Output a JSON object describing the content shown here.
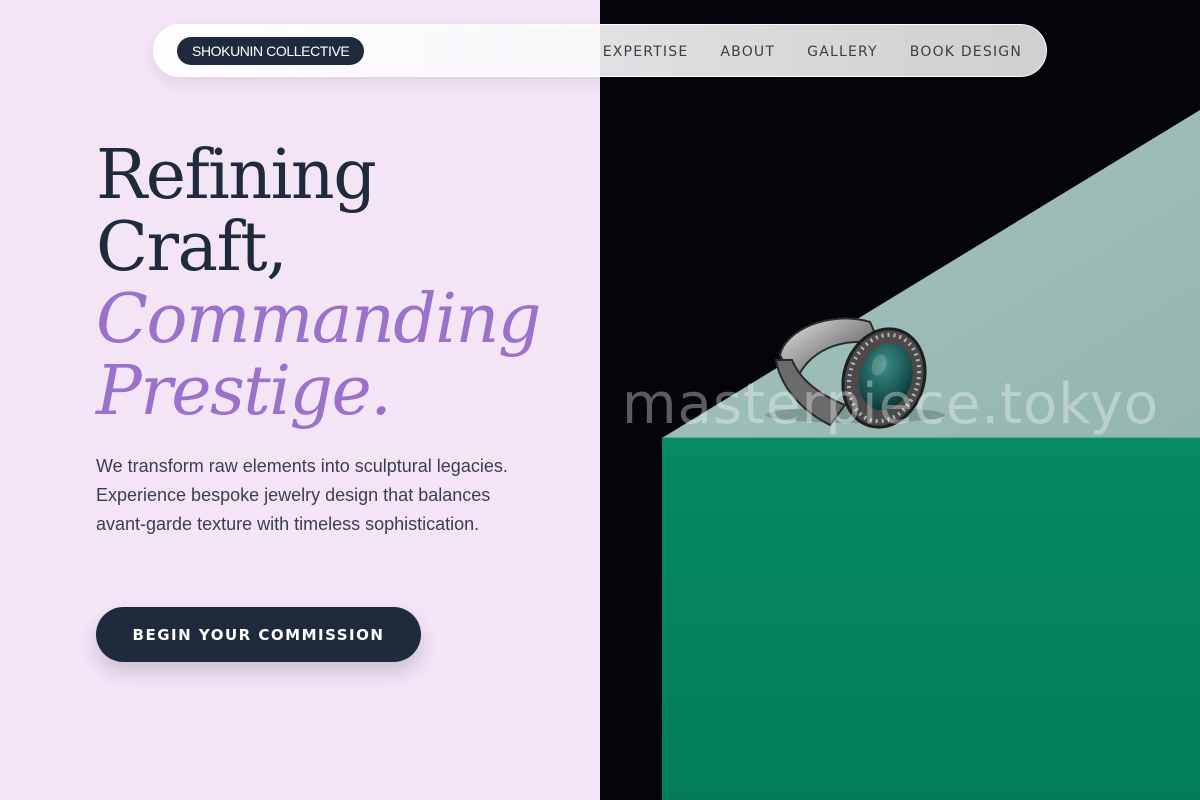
{
  "nav": {
    "brand": "SHOKUNIN COLLECTIVE",
    "links": [
      "EXPERTISE",
      "ABOUT",
      "GALLERY",
      "BOOK DESIGN"
    ]
  },
  "hero": {
    "headline_line1": "Refining",
    "headline_line2": "Craft,",
    "headline_line3": "Commanding",
    "headline_line4": "Prestige.",
    "subtitle": "We transform raw elements into sculptural legacies. Experience bespoke jewelry design that balances avant-garde texture with timeless sophistication.",
    "cta": "BEGIN YOUR COMMISSION"
  },
  "image": {
    "subject": "silver signet ring with green stone on green block",
    "watermark": "masterpiece.tokyo"
  },
  "colors": {
    "background_left": "#f3e4f6",
    "primary_dark": "#1f2a3c",
    "accent_purple": "#9a72cb",
    "image_black": "#04050a",
    "image_green": "#03845f",
    "image_mint": "#9dbdb8"
  }
}
